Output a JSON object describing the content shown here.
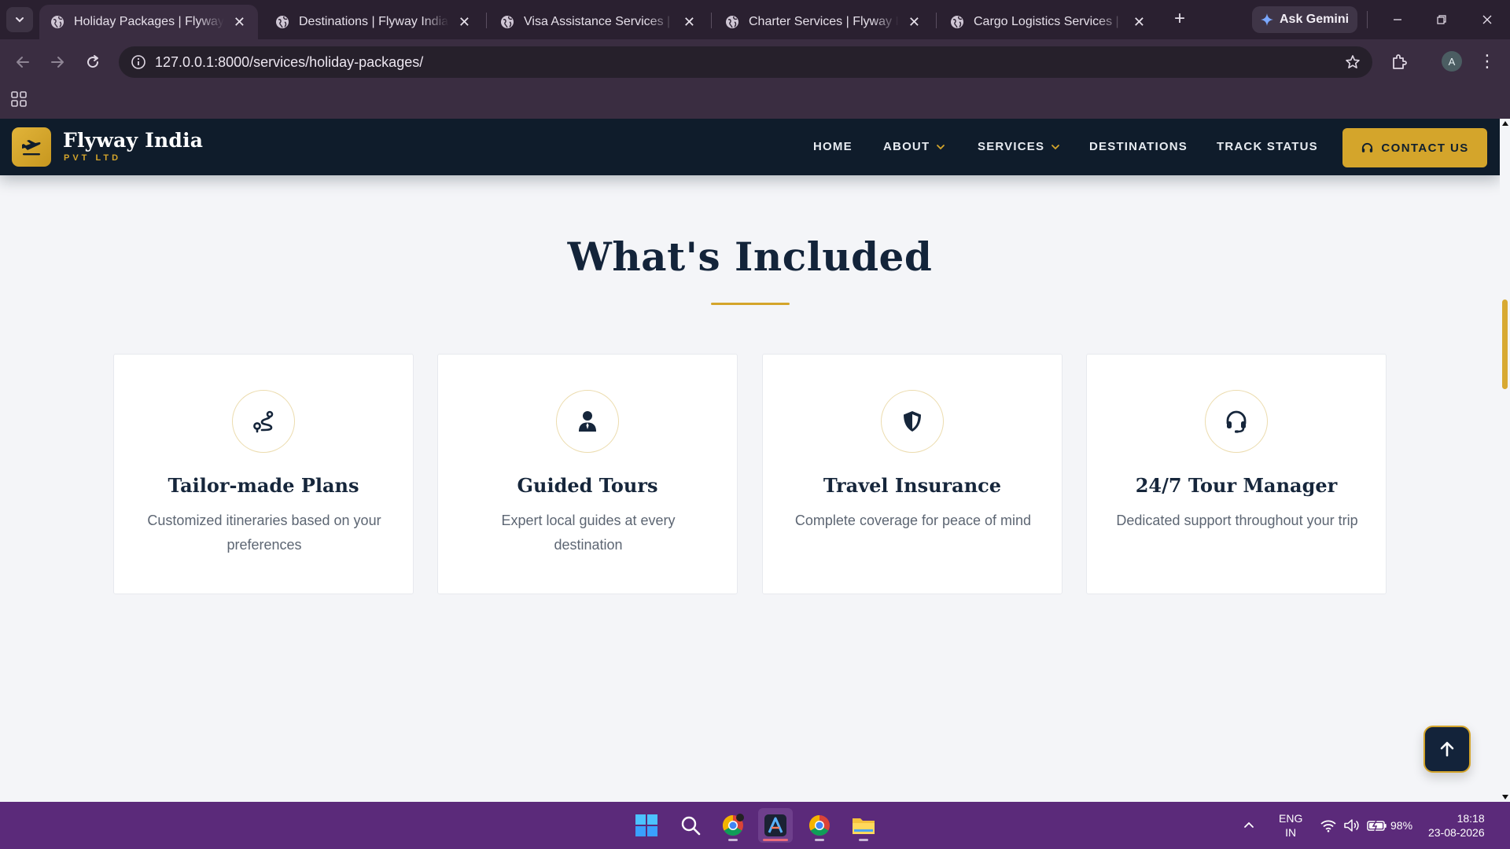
{
  "browser": {
    "tabs": [
      {
        "title": "Holiday Packages | Flyway India Pvt Ltd",
        "active": true
      },
      {
        "title": "Destinations | Flyway India Pvt Ltd",
        "active": false
      },
      {
        "title": "Visa Assistance Services | Flyway India",
        "active": false
      },
      {
        "title": "Charter Services | Flyway India Pvt Ltd",
        "active": false
      },
      {
        "title": "Cargo Logistics Services | Flyway India",
        "active": false
      }
    ],
    "gemini_label": "Ask Gemini",
    "url": "127.0.0.1:8000/services/holiday-packages/",
    "profile_initial": "A"
  },
  "site": {
    "brand_name": "Flyway India",
    "brand_sub": "PVT LTD",
    "nav": {
      "home": "HOME",
      "about": "ABOUT",
      "services": "SERVICES",
      "destinations": "DESTINATIONS",
      "track": "TRACK STATUS",
      "contact": "CONTACT US"
    },
    "accent_color": "#d4a52b",
    "navy_color": "#0f1c2b"
  },
  "section": {
    "title": "What's Included",
    "cards": [
      {
        "icon": "route-icon",
        "title": "Tailor-made Plans",
        "text": "Customized itineraries based on your preferences"
      },
      {
        "icon": "user-tie-icon",
        "title": "Guided Tours",
        "text": "Expert local guides at every destination"
      },
      {
        "icon": "shield-icon",
        "title": "Travel Insurance",
        "text": "Complete coverage for peace of mind"
      },
      {
        "icon": "headset-icon",
        "title": "24/7 Tour Manager",
        "text": "Dedicated support throughout your trip"
      }
    ]
  },
  "taskbar": {
    "lang_line1": "ENG",
    "lang_line2": "IN",
    "battery": "98%",
    "time": "18:18",
    "date": "23-08-2026"
  }
}
